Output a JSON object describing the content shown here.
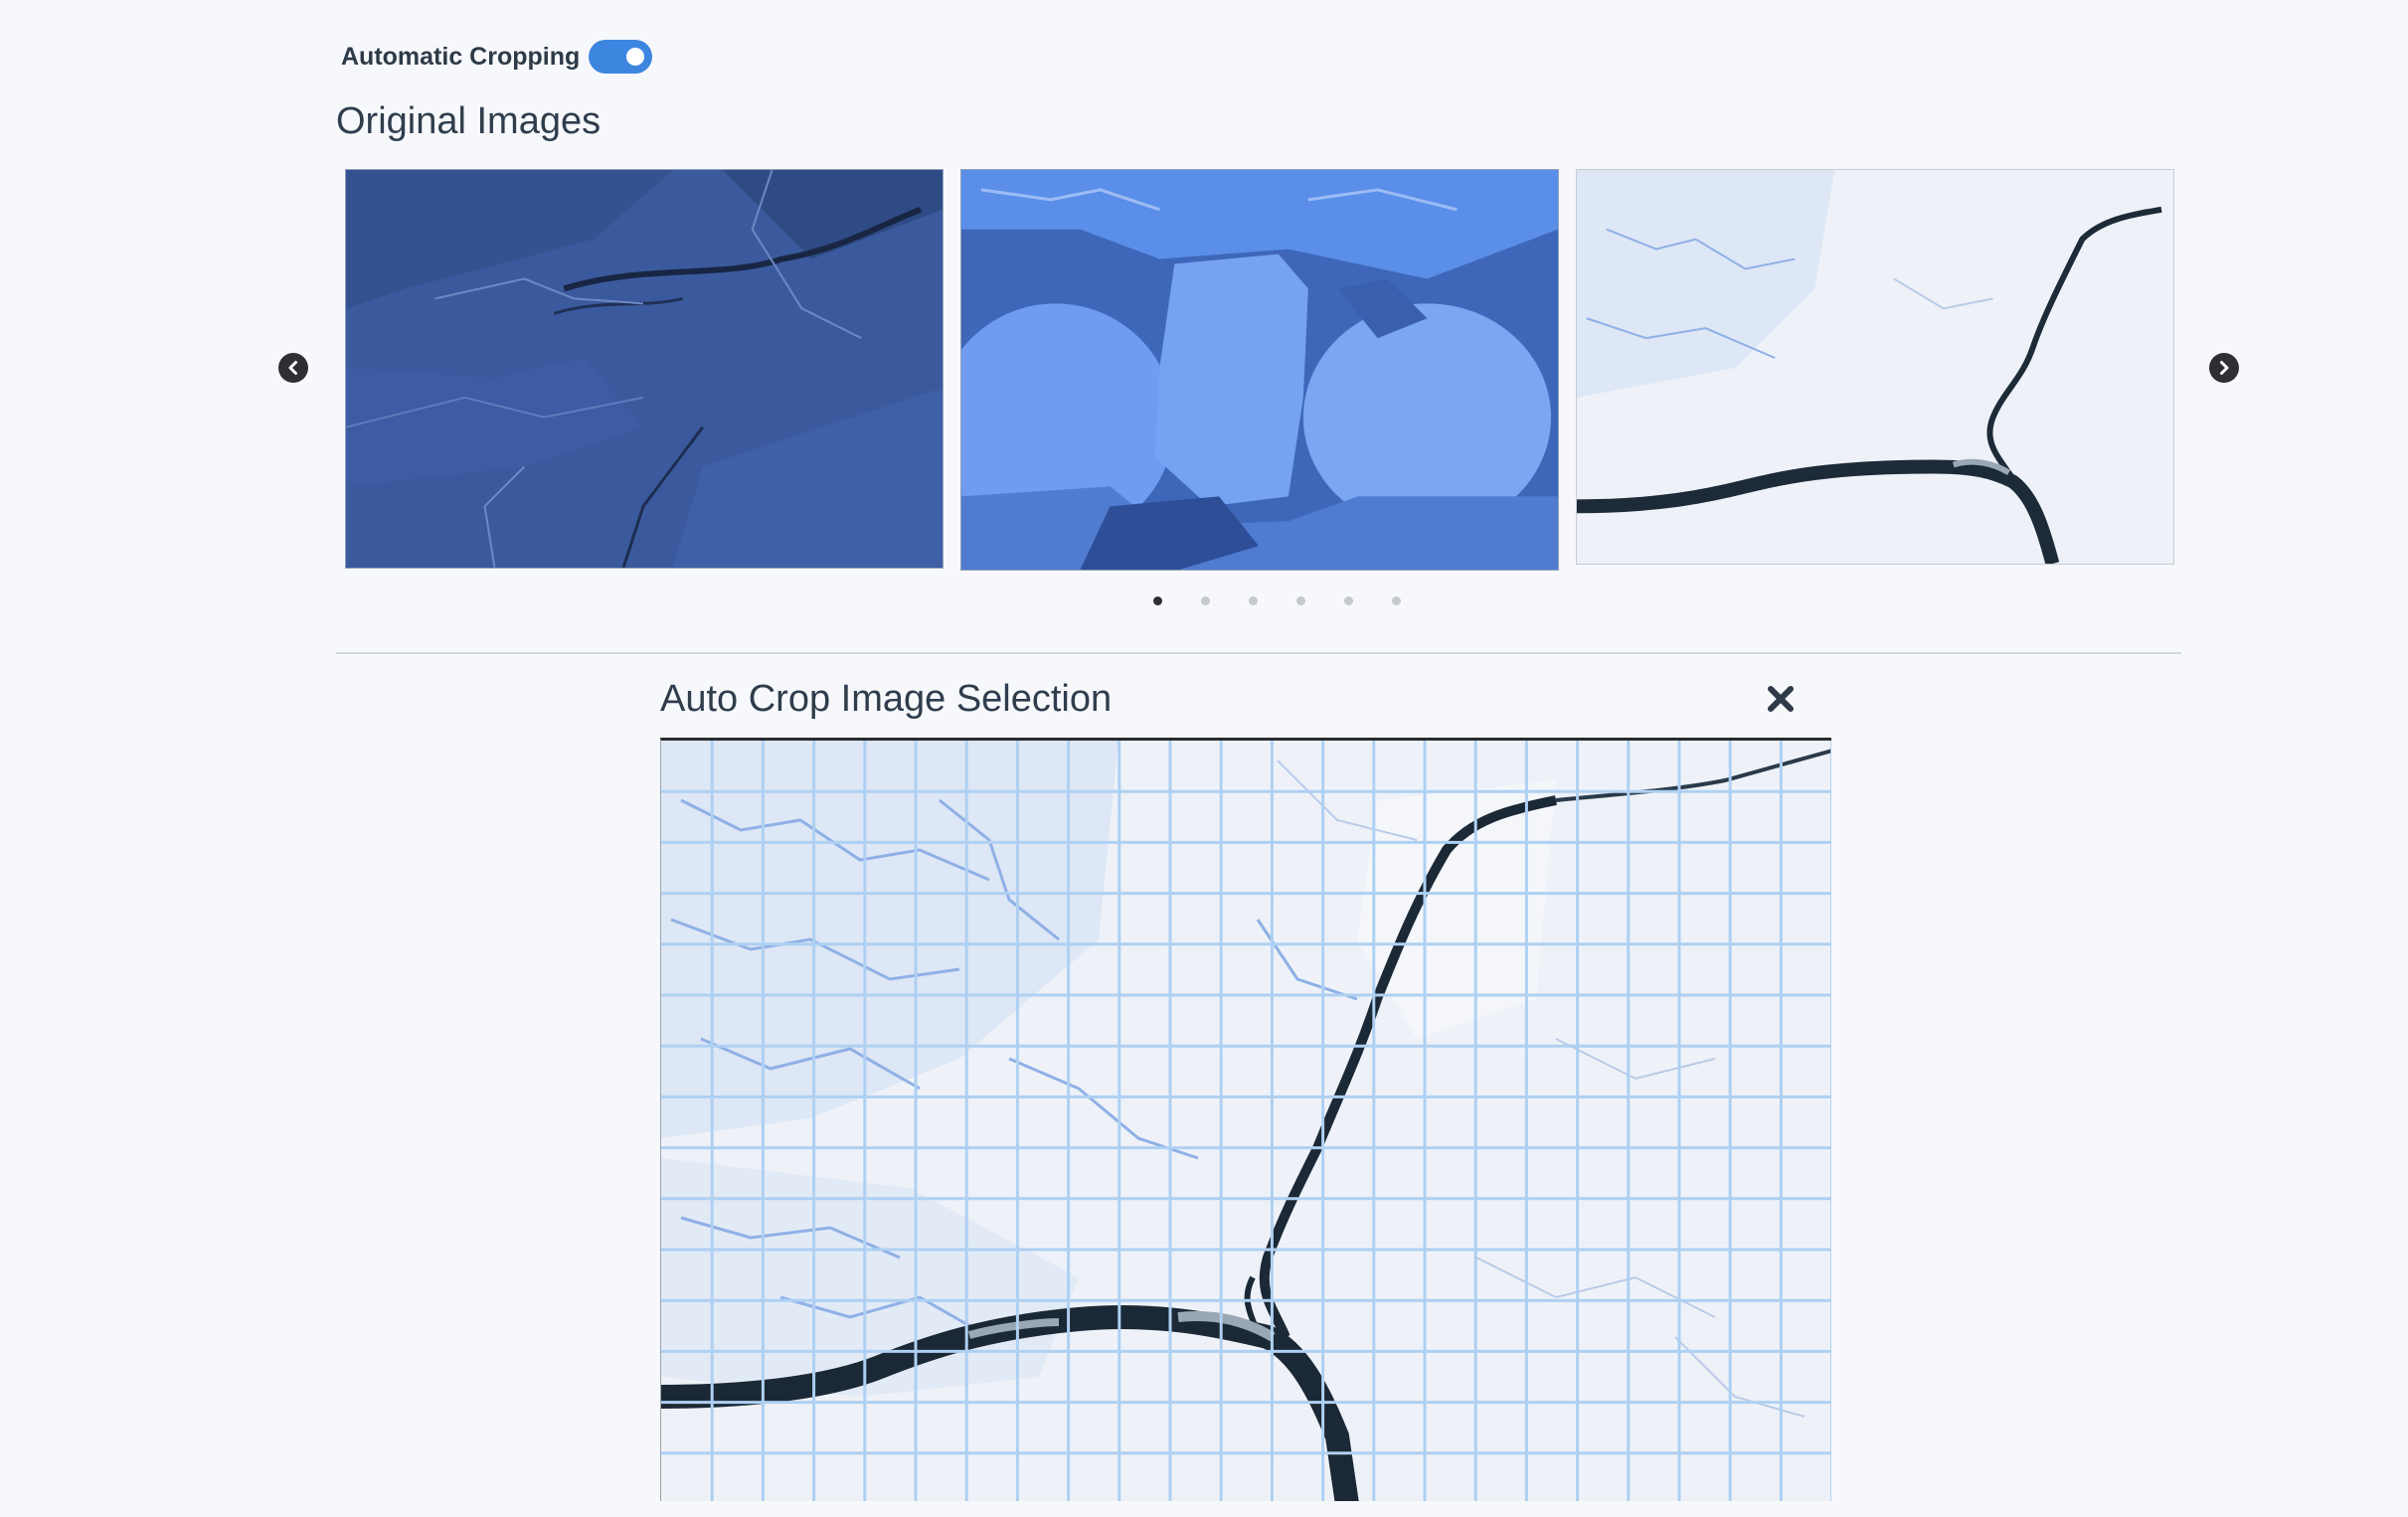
{
  "settings": {
    "auto_crop_label": "Automatic Cropping",
    "auto_crop_enabled": true
  },
  "original_images": {
    "title": "Original Images",
    "images": [
      {
        "icon": "sea-ice-dark-blue-image"
      },
      {
        "icon": "ice-floes-blue-image"
      },
      {
        "icon": "ice-crack-white-image"
      }
    ],
    "page_count": 6,
    "active_page": 1
  },
  "auto_crop": {
    "title": "Auto Crop Image Selection",
    "close_icon": "close-icon",
    "grid_color": "#aed0f2"
  },
  "colors": {
    "accent": "#3d86e0",
    "dark_blue_ice": "#3b5a9e",
    "blue_ice": "#5a8ee8",
    "white_ice": "#eef2f8"
  }
}
